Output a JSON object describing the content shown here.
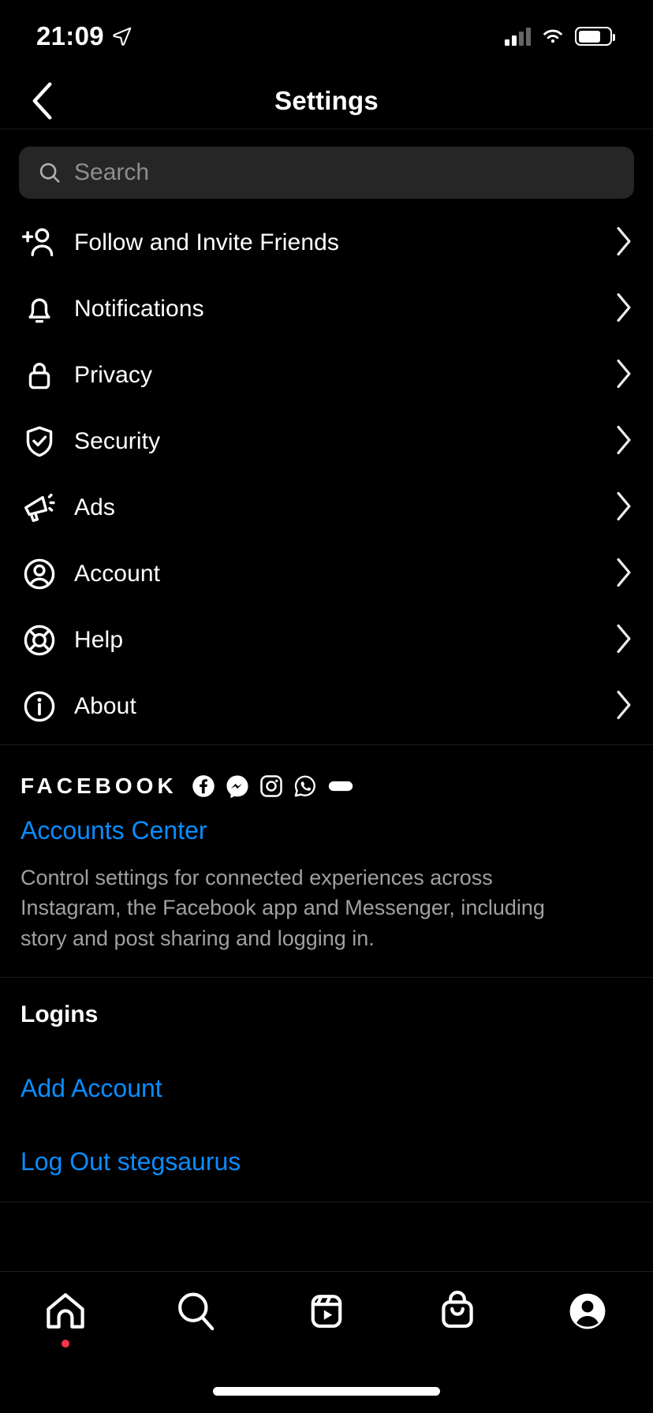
{
  "status_bar": {
    "time": "21:09",
    "location_icon": "location-arrow-icon",
    "cellular_icon": "cellular-signal-icon",
    "wifi_icon": "wifi-icon",
    "battery_icon": "battery-icon"
  },
  "nav": {
    "back_icon": "chevron-left-icon",
    "title": "Settings"
  },
  "search": {
    "icon": "search-icon",
    "placeholder": "Search",
    "value": ""
  },
  "settings_items": [
    {
      "label": "Follow and Invite Friends",
      "icon": "person-plus-icon",
      "chevron": "chevron-right-icon"
    },
    {
      "label": "Notifications",
      "icon": "bell-icon",
      "chevron": "chevron-right-icon"
    },
    {
      "label": "Privacy",
      "icon": "lock-icon",
      "chevron": "chevron-right-icon"
    },
    {
      "label": "Security",
      "icon": "shield-check-icon",
      "chevron": "chevron-right-icon"
    },
    {
      "label": "Ads",
      "icon": "megaphone-icon",
      "chevron": "chevron-right-icon"
    },
    {
      "label": "Account",
      "icon": "user-circle-icon",
      "chevron": "chevron-right-icon"
    },
    {
      "label": "Help",
      "icon": "lifebuoy-icon",
      "chevron": "chevron-right-icon"
    },
    {
      "label": "About",
      "icon": "info-circle-icon",
      "chevron": "chevron-right-icon"
    }
  ],
  "facebook_section": {
    "wordmark": "FACEBOOK",
    "brand_icons": [
      "facebook-icon",
      "messenger-icon",
      "instagram-icon",
      "whatsapp-icon",
      "oculus-icon"
    ],
    "accounts_center_label": "Accounts Center",
    "description": "Control settings for connected experiences across Instagram, the Facebook app and Messenger, including story and post sharing and logging in."
  },
  "logins_section": {
    "heading": "Logins",
    "add_account_label": "Add Account",
    "log_out_label": "Log Out stegsaurus"
  },
  "tab_bar": [
    {
      "name": "home",
      "icon": "home-icon",
      "active": false,
      "badge": true
    },
    {
      "name": "search",
      "icon": "search-icon",
      "active": false,
      "badge": false
    },
    {
      "name": "reels",
      "icon": "reels-icon",
      "active": false,
      "badge": false
    },
    {
      "name": "shop",
      "icon": "shopping-bag-icon",
      "active": false,
      "badge": false
    },
    {
      "name": "profile",
      "icon": "profile-avatar-icon",
      "active": true,
      "badge": false
    }
  ],
  "colors": {
    "background": "#000000",
    "link_blue": "#0a8cff",
    "search_field": "#262626",
    "secondary_text": "#a0a0a0",
    "badge_red": "#ff3250"
  }
}
